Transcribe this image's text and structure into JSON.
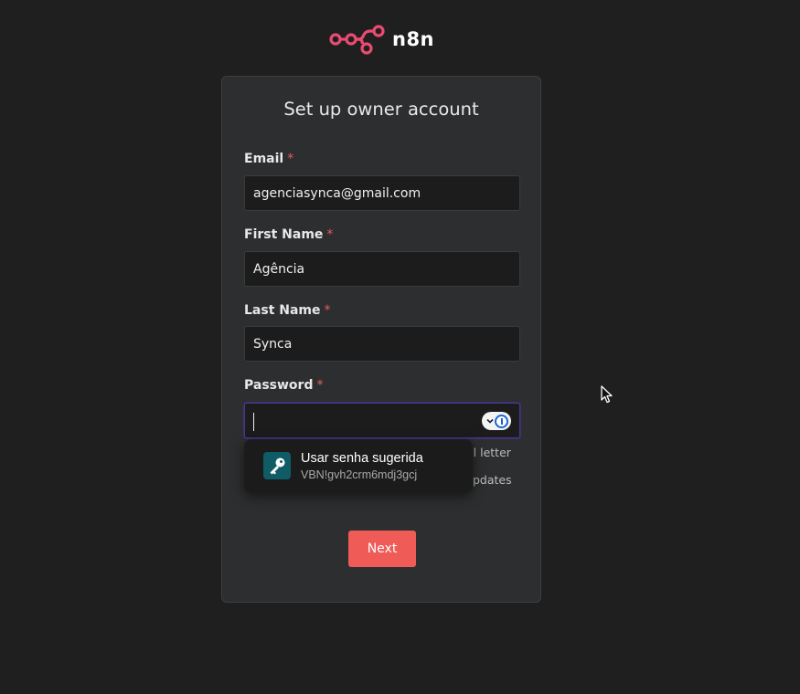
{
  "brand": {
    "name": "n8n",
    "logo_icon": "n8n-logo-icon",
    "color": "#ea4b71"
  },
  "form": {
    "title": "Set up owner account",
    "required_marker": "*",
    "email": {
      "label": "Email",
      "value": "agenciasynca@gmail.com"
    },
    "first_name": {
      "label": "First Name",
      "value": "Agência"
    },
    "last_name": {
      "label": "Last Name",
      "value": "Synca"
    },
    "password": {
      "label": "Password",
      "value": "",
      "hint_partial_1": "al letter",
      "hint_partial_2": "pdates"
    },
    "next_label": "Next",
    "accent_color": "#ef5b56"
  },
  "password_suggestion": {
    "title": "Usar senha sugerida",
    "password": "VBN!gvh2crm6mdj3gcj",
    "icon": "key-icon"
  },
  "password_manager": {
    "icon": "password-manager-icon"
  }
}
